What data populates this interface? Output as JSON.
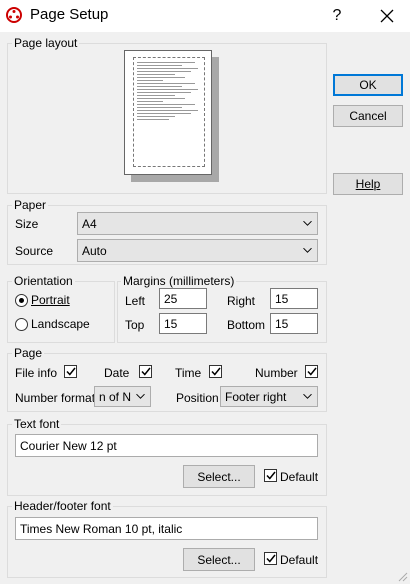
{
  "window": {
    "title": "Page Setup",
    "help_glyph": "?",
    "close_glyph": "✕"
  },
  "page_layout": {
    "label": "Page layout"
  },
  "buttons": {
    "ok": "OK",
    "cancel": "Cancel",
    "help": "Help"
  },
  "paper": {
    "label": "Paper",
    "size_label": "Size",
    "size_value": "A4",
    "source_label": "Source",
    "source_value": "Auto"
  },
  "orientation": {
    "label": "Orientation",
    "portrait": "Portrait",
    "landscape": "Landscape",
    "selected": "Portrait"
  },
  "margins": {
    "label": "Margins (millimeters)",
    "left_label": "Left",
    "left_value": "25",
    "right_label": "Right",
    "right_value": "15",
    "top_label": "Top",
    "top_value": "15",
    "bottom_label": "Bottom",
    "bottom_value": "15"
  },
  "page": {
    "label": "Page",
    "file_info": "File info",
    "file_info_checked": true,
    "date": "Date",
    "date_checked": true,
    "time": "Time",
    "time_checked": true,
    "number": "Number",
    "number_checked": true,
    "number_format_label": "Number format",
    "number_format_value": "n of N",
    "position_label": "Position",
    "position_value": "Footer right"
  },
  "text_font": {
    "label": "Text font",
    "value": "Courier New 12 pt",
    "select": "Select...",
    "default_label": "Default",
    "default_checked": true
  },
  "header_font": {
    "label": "Header/footer font",
    "value": "Times New Roman 10 pt, italic",
    "select": "Select...",
    "default_label": "Default",
    "default_checked": true
  },
  "icons": {
    "app": "app-icon",
    "chevron": "chevron-down-icon",
    "check": "check-icon"
  }
}
